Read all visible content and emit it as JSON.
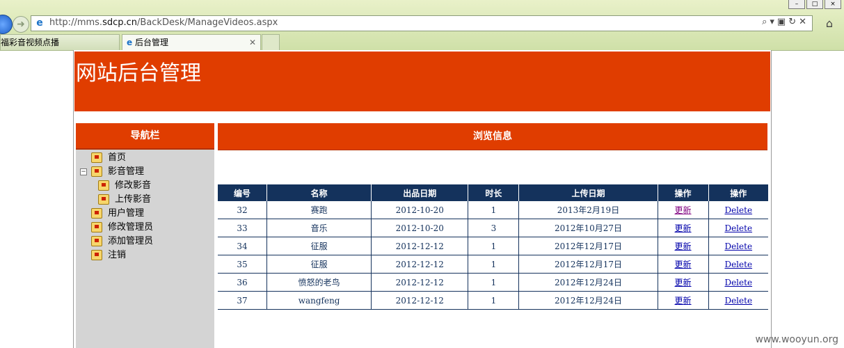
{
  "browser": {
    "url_prefix": "http://mms.",
    "url_domain": "sdcp.cn",
    "url_path": "/BackDesk/ManageVideos.aspx",
    "tabs": [
      {
        "label": "福彩音视频点播"
      },
      {
        "label": "后台管理"
      }
    ]
  },
  "banner": {
    "title": "网站后台管理"
  },
  "sidebar": {
    "heading": "导航栏",
    "items": [
      {
        "label": "首页",
        "level": 0
      },
      {
        "label": "影音管理",
        "level": 0,
        "toggle": "−"
      },
      {
        "label": "修改影音",
        "level": 1
      },
      {
        "label": "上传影音",
        "level": 1
      },
      {
        "label": "用户管理",
        "level": 0
      },
      {
        "label": "修改管理员",
        "level": 0
      },
      {
        "label": "添加管理员",
        "level": 0
      },
      {
        "label": "注销",
        "level": 0
      }
    ]
  },
  "main": {
    "heading": "浏览信息",
    "columns": [
      "编号",
      "名称",
      "出品日期",
      "时长",
      "上传日期",
      "操作",
      "操作"
    ],
    "rows": [
      {
        "id": "32",
        "name": "赛跑",
        "prod_date": "2012-10-20",
        "duration": "1",
        "upload_date": "2013年2月19日",
        "update": "更新",
        "delete": "Delete"
      },
      {
        "id": "33",
        "name": "音乐",
        "prod_date": "2012-10-20",
        "duration": "3",
        "upload_date": "2012年10月27日",
        "update": "更新",
        "delete": "Delete"
      },
      {
        "id": "34",
        "name": "征服",
        "prod_date": "2012-12-12",
        "duration": "1",
        "upload_date": "2012年12月17日",
        "update": "更新",
        "delete": "Delete"
      },
      {
        "id": "35",
        "name": "征服",
        "prod_date": "2012-12-12",
        "duration": "1",
        "upload_date": "2012年12月17日",
        "update": "更新",
        "delete": "Delete"
      },
      {
        "id": "36",
        "name": "愤怒的老鸟",
        "prod_date": "2012-12-12",
        "duration": "1",
        "upload_date": "2012年12月24日",
        "update": "更新",
        "delete": "Delete"
      },
      {
        "id": "37",
        "name": "wangfeng",
        "prod_date": "2012-12-12",
        "duration": "1",
        "upload_date": "2012年12月24日",
        "update": "更新",
        "delete": "Delete"
      }
    ]
  },
  "watermark": "www.wooyun.org"
}
